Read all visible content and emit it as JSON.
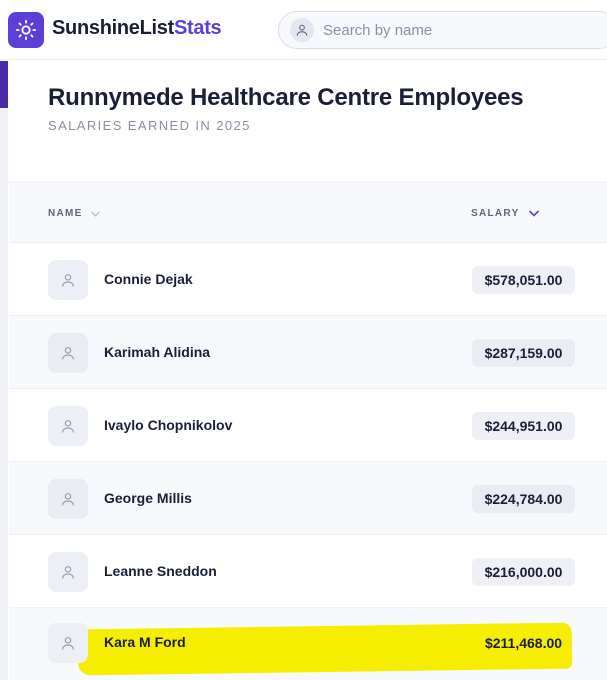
{
  "header": {
    "brand_part1": "SunshineList",
    "brand_part2": "Stats",
    "search_placeholder": "Search by name",
    "search_value": ""
  },
  "page": {
    "title": "Runnymede Healthcare Centre Employees",
    "subtitle": "SALARIES EARNED IN 2025"
  },
  "table": {
    "col_name": "NAME",
    "col_salary": "SALARY",
    "rows": [
      {
        "name": "Connie Dejak",
        "salary": "$578,051.00"
      },
      {
        "name": "Karimah Alidina",
        "salary": "$287,159.00"
      },
      {
        "name": "Ivaylo Chopnikolov",
        "salary": "$244,951.00"
      },
      {
        "name": "George Millis",
        "salary": "$224,784.00"
      },
      {
        "name": "Leanne Sneddon",
        "salary": "$216,000.00"
      },
      {
        "name": "Kara M Ford",
        "salary": "$211,468.00"
      }
    ]
  },
  "colors": {
    "brand": "#5b3fd6",
    "highlight": "#f5ee00"
  },
  "icons": {
    "logo": "sun-icon",
    "search": "user-icon",
    "avatar": "user-icon",
    "sort": "chevron-down-icon"
  }
}
